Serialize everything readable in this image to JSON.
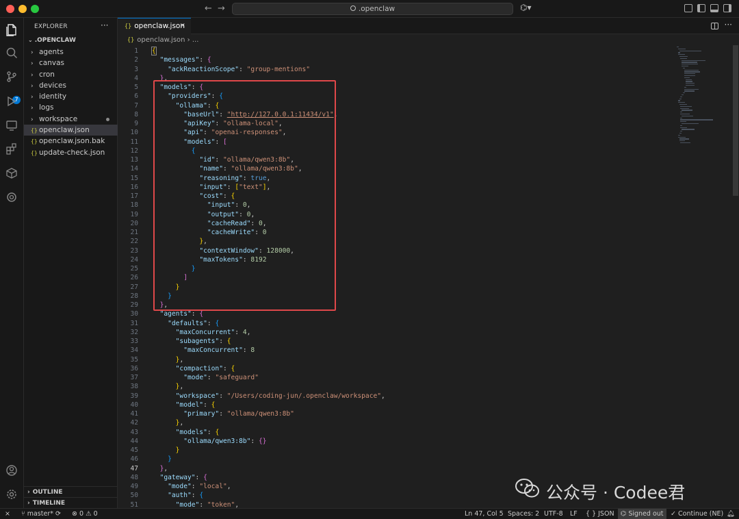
{
  "titlebar": {
    "search_text": ".openclaw",
    "back_icon": "arrow-left-icon",
    "forward_icon": "arrow-right-icon"
  },
  "sidebar": {
    "title": "EXPLORER",
    "more": "···",
    "root": ".OPENCLAW",
    "items": [
      {
        "type": "folder",
        "label": "agents"
      },
      {
        "type": "folder",
        "label": "canvas"
      },
      {
        "type": "folder",
        "label": "cron"
      },
      {
        "type": "folder",
        "label": "devices"
      },
      {
        "type": "folder",
        "label": "identity"
      },
      {
        "type": "folder",
        "label": "logs"
      },
      {
        "type": "folder",
        "label": "workspace",
        "modified": true
      },
      {
        "type": "file",
        "label": "openclaw.json",
        "selected": true
      },
      {
        "type": "file",
        "label": "openclaw.json.bak"
      },
      {
        "type": "file",
        "label": "update-check.json"
      }
    ],
    "outline": "OUTLINE",
    "timeline": "TIMELINE"
  },
  "tab": {
    "label": "openclaw.json",
    "icon_text": "{}",
    "close": "×"
  },
  "breadcrumb": {
    "file": "openclaw.json",
    "sep": " › ",
    "rest": "..."
  },
  "editor": {
    "current_line": 47,
    "lines": [
      [
        [
          "br1",
          "{"
        ]
      ],
      [
        [
          "p",
          "  "
        ],
        [
          "k",
          "\"messages\""
        ],
        [
          "p",
          ": "
        ],
        [
          "br2",
          "{"
        ]
      ],
      [
        [
          "p",
          "    "
        ],
        [
          "k",
          "\"ackReactionScope\""
        ],
        [
          "p",
          ": "
        ],
        [
          "s",
          "\"group-mentions\""
        ]
      ],
      [
        [
          "p",
          "  "
        ],
        [
          "br2",
          "}"
        ],
        [
          "p",
          ","
        ]
      ],
      [
        [
          "p",
          "  "
        ],
        [
          "k",
          "\"models\""
        ],
        [
          "p",
          ": "
        ],
        [
          "br2",
          "{"
        ]
      ],
      [
        [
          "p",
          "    "
        ],
        [
          "k",
          "\"providers\""
        ],
        [
          "p",
          ": "
        ],
        [
          "br3",
          "{"
        ]
      ],
      [
        [
          "p",
          "      "
        ],
        [
          "k",
          "\"ollama\""
        ],
        [
          "p",
          ": "
        ],
        [
          "br1",
          "{"
        ]
      ],
      [
        [
          "p",
          "        "
        ],
        [
          "k",
          "\"baseUrl\""
        ],
        [
          "p",
          ": "
        ],
        [
          "su",
          "\"http://127.0.0.1:11434/v1\""
        ],
        [
          "p",
          ","
        ]
      ],
      [
        [
          "p",
          "        "
        ],
        [
          "k",
          "\"apiKey\""
        ],
        [
          "p",
          ": "
        ],
        [
          "s",
          "\"ollama-local\""
        ],
        [
          "p",
          ","
        ]
      ],
      [
        [
          "p",
          "        "
        ],
        [
          "k",
          "\"api\""
        ],
        [
          "p",
          ": "
        ],
        [
          "s",
          "\"openai-responses\""
        ],
        [
          "p",
          ","
        ]
      ],
      [
        [
          "p",
          "        "
        ],
        [
          "k",
          "\"models\""
        ],
        [
          "p",
          ": "
        ],
        [
          "br2",
          "["
        ]
      ],
      [
        [
          "p",
          "          "
        ],
        [
          "br3",
          "{"
        ]
      ],
      [
        [
          "p",
          "            "
        ],
        [
          "k",
          "\"id\""
        ],
        [
          "p",
          ": "
        ],
        [
          "s",
          "\"ollama/qwen3:8b\""
        ],
        [
          "p",
          ","
        ]
      ],
      [
        [
          "p",
          "            "
        ],
        [
          "k",
          "\"name\""
        ],
        [
          "p",
          ": "
        ],
        [
          "s",
          "\"ollama/qwen3:8b\""
        ],
        [
          "p",
          ","
        ]
      ],
      [
        [
          "p",
          "            "
        ],
        [
          "k",
          "\"reasoning\""
        ],
        [
          "p",
          ": "
        ],
        [
          "b",
          "true"
        ],
        [
          "p",
          ","
        ]
      ],
      [
        [
          "p",
          "            "
        ],
        [
          "k",
          "\"input\""
        ],
        [
          "p",
          ": "
        ],
        [
          "br1",
          "["
        ],
        [
          "s",
          "\"text\""
        ],
        [
          "br1",
          "]"
        ],
        [
          "p",
          ","
        ]
      ],
      [
        [
          "p",
          "            "
        ],
        [
          "k",
          "\"cost\""
        ],
        [
          "p",
          ": "
        ],
        [
          "br1",
          "{"
        ]
      ],
      [
        [
          "p",
          "              "
        ],
        [
          "k",
          "\"input\""
        ],
        [
          "p",
          ": "
        ],
        [
          "n",
          "0"
        ],
        [
          "p",
          ","
        ]
      ],
      [
        [
          "p",
          "              "
        ],
        [
          "k",
          "\"output\""
        ],
        [
          "p",
          ": "
        ],
        [
          "n",
          "0"
        ],
        [
          "p",
          ","
        ]
      ],
      [
        [
          "p",
          "              "
        ],
        [
          "k",
          "\"cacheRead\""
        ],
        [
          "p",
          ": "
        ],
        [
          "n",
          "0"
        ],
        [
          "p",
          ","
        ]
      ],
      [
        [
          "p",
          "              "
        ],
        [
          "k",
          "\"cacheWrite\""
        ],
        [
          "p",
          ": "
        ],
        [
          "n",
          "0"
        ]
      ],
      [
        [
          "p",
          "            "
        ],
        [
          "br1",
          "}"
        ],
        [
          "p",
          ","
        ]
      ],
      [
        [
          "p",
          "            "
        ],
        [
          "k",
          "\"contextWindow\""
        ],
        [
          "p",
          ": "
        ],
        [
          "n",
          "128000"
        ],
        [
          "p",
          ","
        ]
      ],
      [
        [
          "p",
          "            "
        ],
        [
          "k",
          "\"maxTokens\""
        ],
        [
          "p",
          ": "
        ],
        [
          "n",
          "8192"
        ]
      ],
      [
        [
          "p",
          "          "
        ],
        [
          "br3",
          "}"
        ]
      ],
      [
        [
          "p",
          "        "
        ],
        [
          "br2",
          "]"
        ]
      ],
      [
        [
          "p",
          "      "
        ],
        [
          "br1",
          "}"
        ]
      ],
      [
        [
          "p",
          "    "
        ],
        [
          "br3",
          "}"
        ]
      ],
      [
        [
          "p",
          "  "
        ],
        [
          "br2",
          "}"
        ],
        [
          "p",
          ","
        ]
      ],
      [
        [
          "p",
          "  "
        ],
        [
          "k",
          "\"agents\""
        ],
        [
          "p",
          ": "
        ],
        [
          "br2",
          "{"
        ]
      ],
      [
        [
          "p",
          "    "
        ],
        [
          "k",
          "\"defaults\""
        ],
        [
          "p",
          ": "
        ],
        [
          "br3",
          "{"
        ]
      ],
      [
        [
          "p",
          "      "
        ],
        [
          "k",
          "\"maxConcurrent\""
        ],
        [
          "p",
          ": "
        ],
        [
          "n",
          "4"
        ],
        [
          "p",
          ","
        ]
      ],
      [
        [
          "p",
          "      "
        ],
        [
          "k",
          "\"subagents\""
        ],
        [
          "p",
          ": "
        ],
        [
          "br1",
          "{"
        ]
      ],
      [
        [
          "p",
          "        "
        ],
        [
          "k",
          "\"maxConcurrent\""
        ],
        [
          "p",
          ": "
        ],
        [
          "n",
          "8"
        ]
      ],
      [
        [
          "p",
          "      "
        ],
        [
          "br1",
          "}"
        ],
        [
          "p",
          ","
        ]
      ],
      [
        [
          "p",
          "      "
        ],
        [
          "k",
          "\"compaction\""
        ],
        [
          "p",
          ": "
        ],
        [
          "br1",
          "{"
        ]
      ],
      [
        [
          "p",
          "        "
        ],
        [
          "k",
          "\"mode\""
        ],
        [
          "p",
          ": "
        ],
        [
          "s",
          "\"safeguard\""
        ]
      ],
      [
        [
          "p",
          "      "
        ],
        [
          "br1",
          "}"
        ],
        [
          "p",
          ","
        ]
      ],
      [
        [
          "p",
          "      "
        ],
        [
          "k",
          "\"workspace\""
        ],
        [
          "p",
          ": "
        ],
        [
          "s",
          "\"/Users/coding-jun/.openclaw/workspace\""
        ],
        [
          "p",
          ","
        ]
      ],
      [
        [
          "p",
          "      "
        ],
        [
          "k",
          "\"model\""
        ],
        [
          "p",
          ": "
        ],
        [
          "br1",
          "{"
        ]
      ],
      [
        [
          "p",
          "        "
        ],
        [
          "k",
          "\"primary\""
        ],
        [
          "p",
          ": "
        ],
        [
          "s",
          "\"ollama/qwen3:8b\""
        ]
      ],
      [
        [
          "p",
          "      "
        ],
        [
          "br1",
          "}"
        ],
        [
          "p",
          ","
        ]
      ],
      [
        [
          "p",
          "      "
        ],
        [
          "k",
          "\"models\""
        ],
        [
          "p",
          ": "
        ],
        [
          "br1",
          "{"
        ]
      ],
      [
        [
          "p",
          "        "
        ],
        [
          "k",
          "\"ollama/qwen3:8b\""
        ],
        [
          "p",
          ": "
        ],
        [
          "br2",
          "{}"
        ]
      ],
      [
        [
          "p",
          "      "
        ],
        [
          "br1",
          "}"
        ]
      ],
      [
        [
          "p",
          "    "
        ],
        [
          "br3",
          "}"
        ]
      ],
      [
        [
          "p",
          "  "
        ],
        [
          "br2",
          "}"
        ],
        [
          "p",
          ","
        ]
      ],
      [
        [
          "p",
          "  "
        ],
        [
          "k",
          "\"gateway\""
        ],
        [
          "p",
          ": "
        ],
        [
          "br2",
          "{"
        ]
      ],
      [
        [
          "p",
          "    "
        ],
        [
          "k",
          "\"mode\""
        ],
        [
          "p",
          ": "
        ],
        [
          "s",
          "\"local\""
        ],
        [
          "p",
          ","
        ]
      ],
      [
        [
          "p",
          "    "
        ],
        [
          "k",
          "\"auth\""
        ],
        [
          "p",
          ": "
        ],
        [
          "br3",
          "{"
        ]
      ],
      [
        [
          "p",
          "      "
        ],
        [
          "k",
          "\"mode\""
        ],
        [
          "p",
          ": "
        ],
        [
          "s",
          "\"token\""
        ],
        [
          "p",
          ","
        ]
      ]
    ]
  },
  "watermark": "公众号 · Codee君",
  "statusbar": {
    "branch": "master*",
    "errors": "0",
    "warnings": "0",
    "position": "Ln 47, Col 5",
    "spaces": "Spaces: 2",
    "encoding": "UTF-8",
    "eol": "LF",
    "language": "{ } JSON",
    "signed": "Signed out",
    "continue": "Continue (NE)"
  },
  "colors": {
    "accent": "#0078d4",
    "highlight_box": "#e0484a"
  }
}
